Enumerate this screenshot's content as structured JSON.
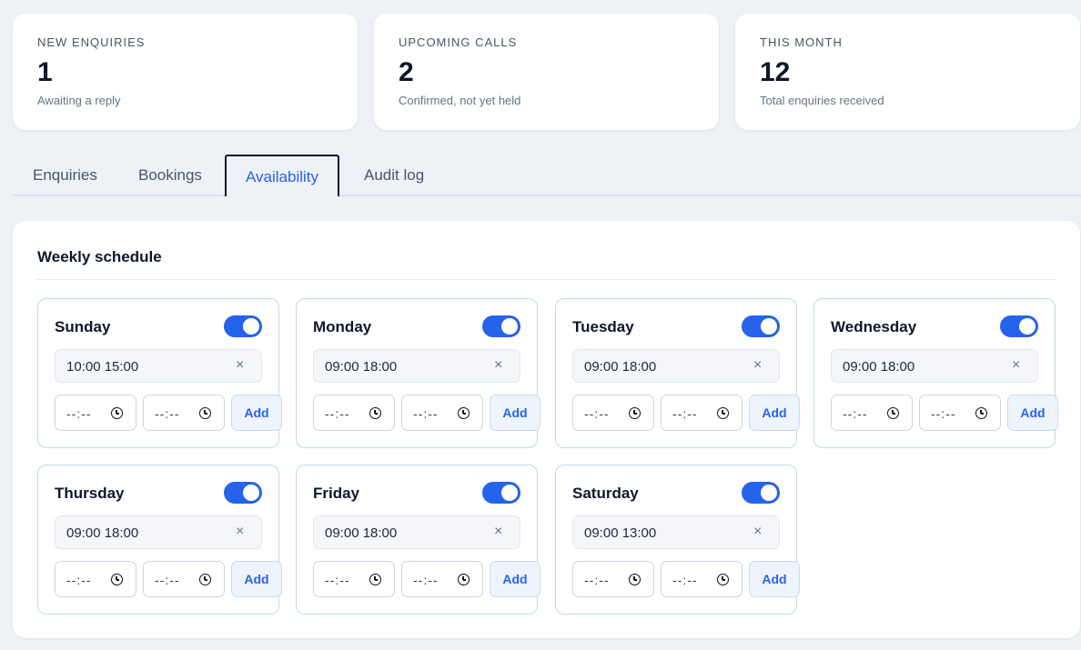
{
  "stats": [
    {
      "label": "NEW ENQUIRIES",
      "value": "1",
      "sub": "Awaiting a reply"
    },
    {
      "label": "UPCOMING CALLS",
      "value": "2",
      "sub": "Confirmed, not yet held"
    },
    {
      "label": "THIS MONTH",
      "value": "12",
      "sub": "Total enquiries received"
    }
  ],
  "tabs": [
    "Enquiries",
    "Bookings",
    "Availability",
    "Audit log"
  ],
  "active_tab": "Availability",
  "schedule": {
    "title": "Weekly schedule",
    "time_placeholder": "--:--",
    "add_label": "Add",
    "remove_glyph": "×",
    "days": [
      {
        "name": "Sunday",
        "enabled": true,
        "slot": "10:00 15:00"
      },
      {
        "name": "Monday",
        "enabled": true,
        "slot": "09:00 18:00"
      },
      {
        "name": "Tuesday",
        "enabled": true,
        "slot": "09:00 18:00"
      },
      {
        "name": "Wednesday",
        "enabled": true,
        "slot": "09:00 18:00"
      },
      {
        "name": "Thursday",
        "enabled": true,
        "slot": "09:00 18:00"
      },
      {
        "name": "Friday",
        "enabled": true,
        "slot": "09:00 18:00"
      },
      {
        "name": "Saturday",
        "enabled": true,
        "slot": "09:00 13:00"
      }
    ]
  },
  "colors": {
    "accent": "#2563eb",
    "background": "#eef2f7"
  }
}
